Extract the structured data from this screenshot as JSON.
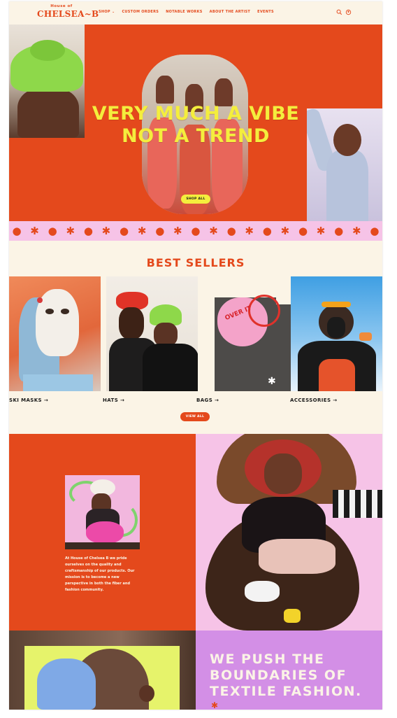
{
  "header": {
    "logo_top": "House of",
    "logo_main": "CHELSEA~B",
    "nav": [
      "SHOP",
      "CUSTOM ORDERS",
      "NOTABLE WORKS",
      "ABOUT THE ARTIST",
      "EVENTS"
    ],
    "shop_caret": "⌄",
    "icons": [
      "search-icon",
      "account-icon"
    ]
  },
  "hero": {
    "title_line1": "VERY MUCH A VIBE",
    "title_line2": "NOT A TREND",
    "cta": "SHOP ALL"
  },
  "band": {
    "pattern": [
      "circle",
      "star",
      "circle",
      "star",
      "circle",
      "star",
      "circle",
      "star",
      "circle",
      "star",
      "circle",
      "star",
      "circle",
      "star",
      "circle",
      "star",
      "circle",
      "star",
      "circle",
      "star",
      "circle"
    ]
  },
  "best_sellers": {
    "title": "BEST SELLERS",
    "categories": [
      {
        "label": "SKI MASKS →"
      },
      {
        "label": "HATS →"
      },
      {
        "label": "BAGS →"
      },
      {
        "label": "ACCESSORIES →"
      }
    ],
    "bag_text": "OVER IT",
    "view_all": "VIEW ALL"
  },
  "about": {
    "text": "At House of Chelsea B we pride ourselves on the quality and craftsmanship of our products. Our mission is to become a new perspective in both the fiber and fashion community."
  },
  "push": {
    "headline": "WE PUSH THE BOUNDARIES OF TEXTILE FASHION."
  },
  "colors": {
    "accent_orange": "#e4491c",
    "accent_yellow": "#f4ee3d",
    "pink": "#f6c3e7",
    "cream": "#fbf4e6",
    "purple": "#d38fe6"
  }
}
